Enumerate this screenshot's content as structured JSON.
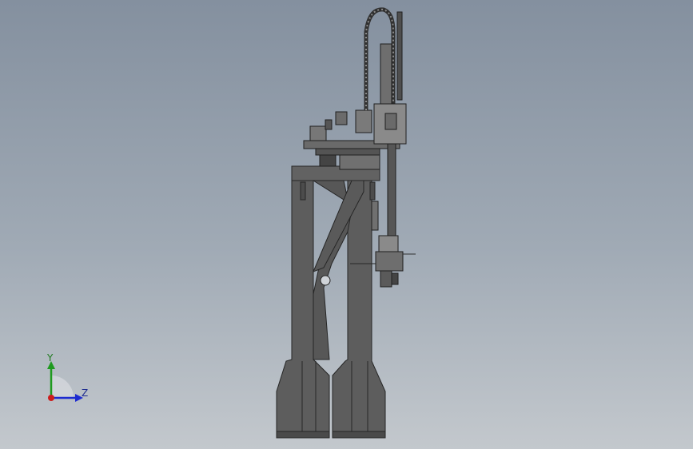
{
  "viewport": {
    "background_top": "#84909f",
    "background_bottom": "#c3c8cd",
    "model_fill": "#5f5f5f",
    "model_edge": "#2a2a2a"
  },
  "triad": {
    "y_label": "Y",
    "z_label": "Z",
    "y_color": "#1f9a1f",
    "z_color": "#1d2bd0",
    "x_color": "#cc1d1d"
  }
}
